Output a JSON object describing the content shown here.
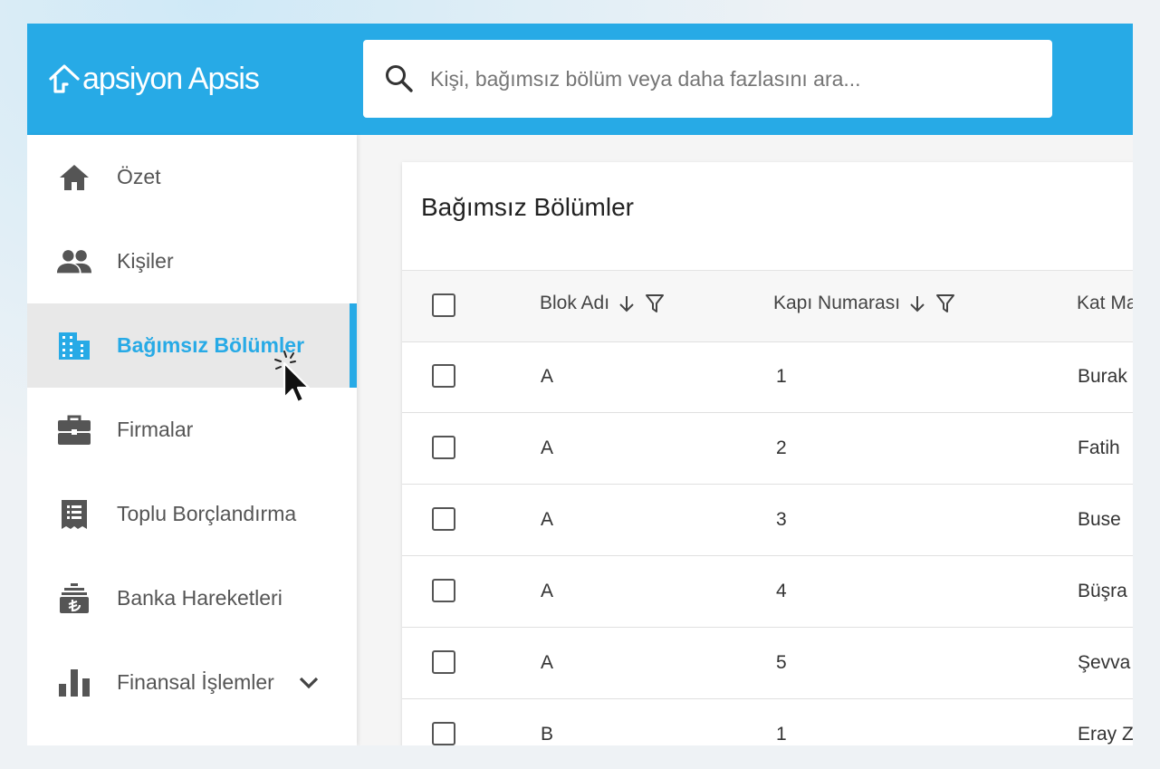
{
  "app": {
    "logo_text": "apsiyon Apsis",
    "brand_color": "#27aae6"
  },
  "search": {
    "placeholder": "Kişi, bağımsız bölüm veya daha fazlasını ara..."
  },
  "sidebar": {
    "items": [
      {
        "label": "Özet",
        "icon": "home-icon"
      },
      {
        "label": "Kişiler",
        "icon": "people-icon"
      },
      {
        "label": "Bağımsız Bölümler",
        "icon": "building-icon",
        "active": true
      },
      {
        "label": "Firmalar",
        "icon": "briefcase-icon"
      },
      {
        "label": "Toplu Borçlandırma",
        "icon": "receipt-icon"
      },
      {
        "label": "Banka Hareketleri",
        "icon": "bank-lira-icon"
      },
      {
        "label": "Finansal İşlemler",
        "icon": "bar-chart-icon",
        "expandable": true
      }
    ]
  },
  "page": {
    "title": "Bağımsız Bölümler"
  },
  "table": {
    "columns": [
      "Blok Adı",
      "Kapı Numarası",
      "Kat Ma"
    ],
    "rows": [
      {
        "blok": "A",
        "kapi": "1",
        "kat": "Burak"
      },
      {
        "blok": "A",
        "kapi": "2",
        "kat": "Fatih"
      },
      {
        "blok": "A",
        "kapi": "3",
        "kat": "Buse"
      },
      {
        "blok": "A",
        "kapi": "4",
        "kat": "Büşra"
      },
      {
        "blok": "A",
        "kapi": "5",
        "kat": "Şevva"
      },
      {
        "blok": "B",
        "kapi": "1",
        "kat": "Eray Z"
      }
    ]
  }
}
